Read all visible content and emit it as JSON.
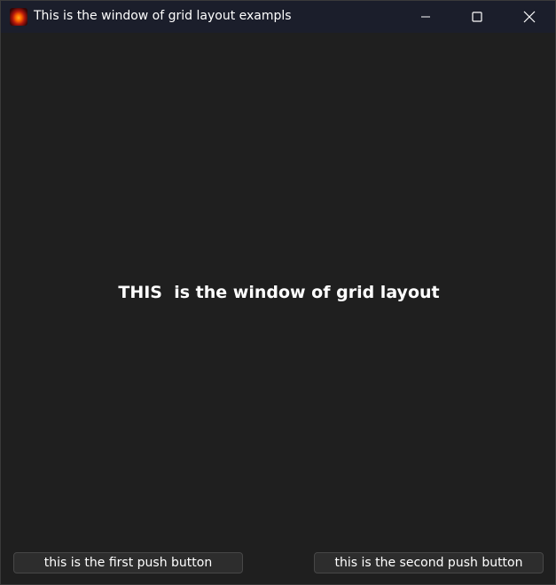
{
  "window": {
    "title": "This is the window of grid layout exampls",
    "app_icon": "app-icon",
    "controls": {
      "minimize": "minimize-icon",
      "maximize": "maximize-icon",
      "close": "close-icon"
    }
  },
  "main": {
    "label": "THIS  is the window of grid layout"
  },
  "buttons": {
    "first_label": "this is the first push button",
    "second_label": "this is the second push button"
  },
  "colors": {
    "background": "#1f1f1f",
    "titlebar": "#1b1e2b",
    "button_bg": "#2d2d2d",
    "button_border": "#474747",
    "text": "#ffffff"
  }
}
